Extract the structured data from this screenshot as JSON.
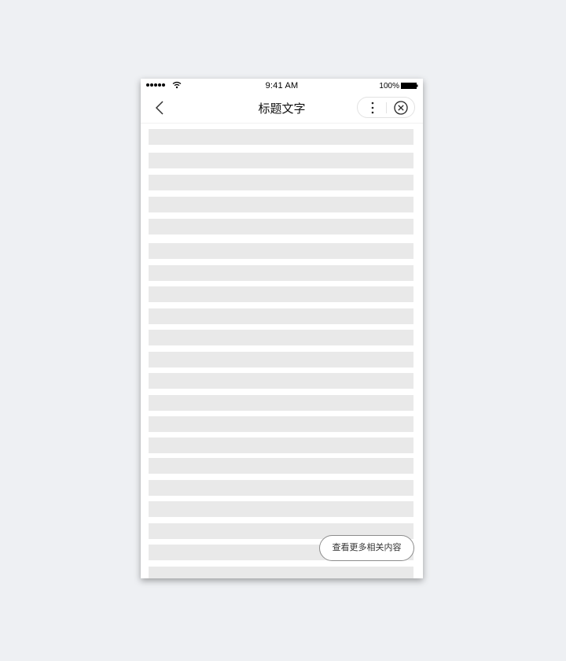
{
  "status_bar": {
    "time": "9:41 AM",
    "battery_percent": "100%",
    "signal_icon": "signal-dots-icon",
    "wifi_icon": "wifi-icon",
    "battery_icon": "battery-icon"
  },
  "nav_bar": {
    "title": "标题文字",
    "back_icon": "chevron-left-icon",
    "more_icon": "more-vertical-icon",
    "close_icon": "close-circle-icon"
  },
  "content": {
    "placeholder_count": 21,
    "placeholder_color": "#e9e9e9"
  },
  "floating_button": {
    "label": "查看更多相关内容"
  },
  "colors": {
    "background": "#eef0f3",
    "card": "#ffffff",
    "text": "#111111"
  }
}
